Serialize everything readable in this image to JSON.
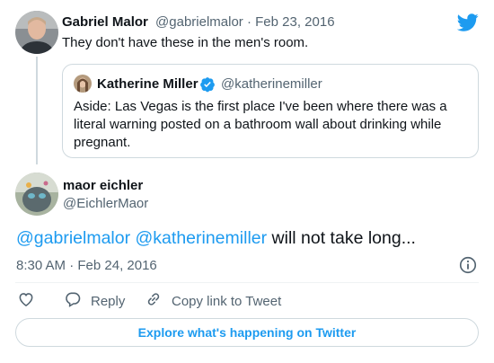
{
  "brand": {
    "accent": "#1d9bf0",
    "logo_icon": "twitter-bird-icon"
  },
  "parent_tweet": {
    "author_name": "Gabriel Malor",
    "author_handle": "@gabrielmalor",
    "separator": "·",
    "date": "Feb 23, 2016",
    "text": "They don't have these in the men's room."
  },
  "quoted_tweet": {
    "author_name": "Katherine Miller",
    "verified_icon": "verified-badge-icon",
    "author_handle": "@katherinemiller",
    "text": "Aside: Las Vegas is the first place I've been where there was a literal warning posted on a bathroom wall about drinking while pregnant."
  },
  "main_tweet": {
    "author_name": "maor eichler",
    "author_handle": "@EichlerMaor",
    "mention_1": "@gabrielmalor",
    "mention_2": "@katherinemiller",
    "text": "will not take long...",
    "timestamp": "8:30 AM · Feb 24, 2016"
  },
  "actions": {
    "like_icon": "heart-icon",
    "reply_icon": "reply-bubble-icon",
    "reply_label": "Reply",
    "copy_icon": "link-icon",
    "copy_label": "Copy link to Tweet",
    "info_icon": "info-icon"
  },
  "footer": {
    "explore_label": "Explore what's happening on Twitter"
  }
}
